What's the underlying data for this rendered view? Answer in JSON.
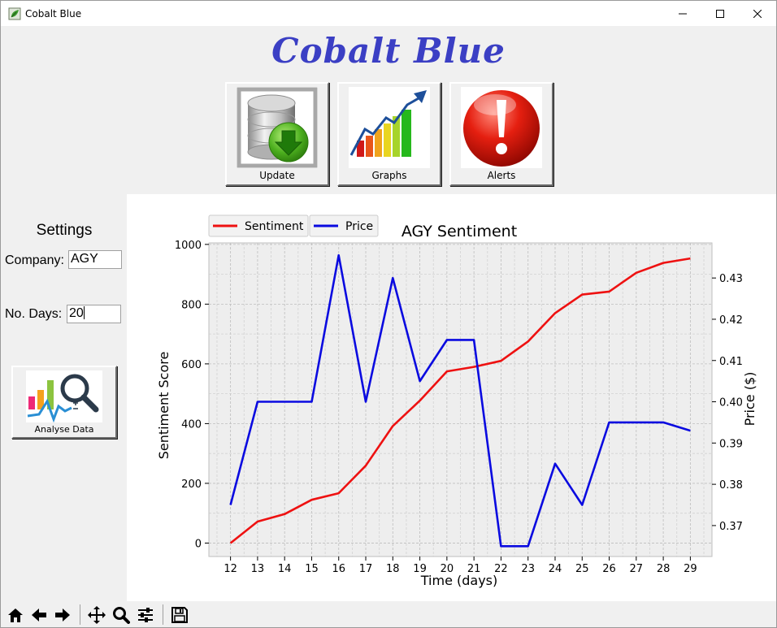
{
  "window": {
    "title": "Cobalt Blue",
    "icon": "app-leaf-icon",
    "controls": [
      "minimize-icon",
      "maximize-icon",
      "close-icon"
    ]
  },
  "header": {
    "title": "Cobalt Blue",
    "color": "#3b3fc4"
  },
  "buttons": {
    "update": {
      "label": "Update",
      "icon": "database-download-icon"
    },
    "graphs": {
      "label": "Graphs",
      "icon": "bar-chart-arrow-icon"
    },
    "alerts": {
      "label": "Alerts",
      "icon": "alert-exclamation-icon"
    }
  },
  "settings": {
    "title": "Settings",
    "company_label": "Company:",
    "company_value": "AGY",
    "days_label": "No. Days:",
    "days_value": "20",
    "analyse_label": "Analyse Data",
    "analyse_icon": "analyse-magnifier-icon"
  },
  "chart_data": {
    "type": "line",
    "title": "AGY Sentiment",
    "xlabel": "Time (days)",
    "ylabel": "Sentiment Score",
    "y2label": "Price ($)",
    "x": [
      12,
      13,
      14,
      15,
      16,
      17,
      18,
      19,
      20,
      21,
      22,
      23,
      24,
      25,
      26,
      27,
      28,
      29
    ],
    "xlim": [
      11.2,
      29.8
    ],
    "ylim": [
      -45,
      1005
    ],
    "y2lim": [
      0.3625,
      0.4385
    ],
    "yticks": [
      0,
      200,
      400,
      600,
      800,
      1000
    ],
    "y2ticks": [
      0.37,
      0.38,
      0.39,
      0.4,
      0.41,
      0.42,
      0.43
    ],
    "y2ticklabels": [
      "0.37",
      "0.38",
      "0.39",
      "0.40",
      "0.41",
      "0.42",
      "0.43"
    ],
    "grid": true,
    "legend_position": "top-left",
    "background": "#eeeeee",
    "series": [
      {
        "name": "Sentiment",
        "axis": "left",
        "color": "#ee1111",
        "values": [
          0,
          72,
          97,
          145,
          167,
          259,
          392,
          477,
          575,
          590,
          610,
          675,
          770,
          832,
          842,
          905,
          938,
          953
        ]
      },
      {
        "name": "Price",
        "axis": "right",
        "color": "#0a0ae0",
        "values": [
          0.375,
          0.4,
          0.4,
          0.4,
          0.4355,
          0.4,
          0.43,
          0.405,
          0.415,
          0.415,
          0.365,
          0.365,
          0.385,
          0.375,
          0.395,
          0.395,
          0.395,
          0.393
        ]
      }
    ]
  },
  "toolbar": {
    "tools": [
      "home-icon",
      "back-arrow-icon",
      "forward-arrow-icon",
      "pan-icon",
      "zoom-icon",
      "configure-subplots-icon",
      "save-icon"
    ]
  }
}
